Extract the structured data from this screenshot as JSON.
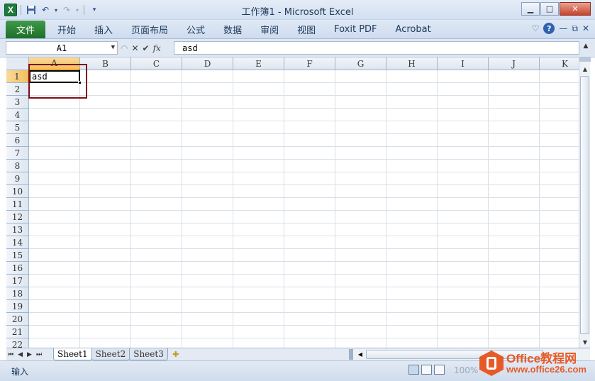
{
  "titlebar": {
    "app_logo": "X",
    "title": "工作簿1 - Microsoft Excel",
    "icons": [
      "excel-logo",
      "save-icon",
      "undo-icon",
      "redo-icon",
      "customize-qat-icon"
    ],
    "window_controls": {
      "minimize": "▁",
      "maximize": "□",
      "close": "✕"
    }
  },
  "ribbon": {
    "file_tab": "文件",
    "tabs": [
      "开始",
      "插入",
      "页面布局",
      "公式",
      "数据",
      "审阅",
      "视图",
      "Foxit PDF",
      "Acrobat"
    ],
    "right_icons": {
      "minimize_ribbon": "♡",
      "help": "?",
      "doc_min": "—",
      "doc_restore": "⧉",
      "doc_close": "✕"
    }
  },
  "formula_bar": {
    "name_box": "A1",
    "cancel": "✕",
    "enter": "✔",
    "fx": "fx",
    "content": "asd"
  },
  "grid": {
    "columns": [
      "A",
      "B",
      "C",
      "D",
      "E",
      "F",
      "G",
      "H",
      "I",
      "J",
      "K"
    ],
    "rows": [
      "1",
      "2",
      "3",
      "4",
      "5",
      "6",
      "7",
      "8",
      "9",
      "10",
      "11",
      "12",
      "13",
      "14",
      "15",
      "16",
      "17",
      "18",
      "19",
      "20",
      "21",
      "22"
    ],
    "active_cell": {
      "ref": "A1",
      "value": "asd"
    }
  },
  "sheet_tabs": {
    "nav": [
      "⏮",
      "◀",
      "▶",
      "⏭"
    ],
    "sheets": [
      "Sheet1",
      "Sheet2",
      "Sheet3"
    ],
    "active": "Sheet1",
    "new_sheet_icon": "✚"
  },
  "status_bar": {
    "mode": "输入",
    "zoom": "100%"
  },
  "watermark": {
    "name": "Office教程网",
    "url": "www.office26.com",
    "logo_color": "#e8531d"
  },
  "colors": {
    "file_tab": "#2e8b3a",
    "selection_header": "#f1c15f",
    "highlight_box": "#7d0f16"
  }
}
